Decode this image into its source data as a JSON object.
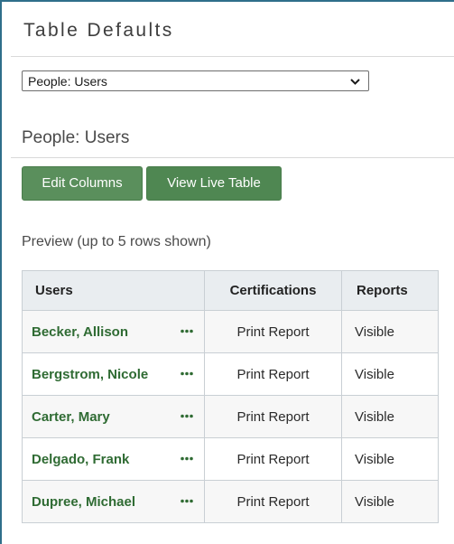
{
  "panel": {
    "title": "Table Defaults"
  },
  "table_select": {
    "value": "People: Users",
    "icon": "chevron-down-icon"
  },
  "section": {
    "title": "People: Users"
  },
  "buttons": {
    "edit_columns": "Edit Columns",
    "view_live_table": "View Live Table"
  },
  "preview": {
    "label": "Preview (up to 5 rows shown)"
  },
  "table": {
    "headers": [
      "Users",
      "Certifications",
      "Reports"
    ],
    "row_action_icon": "more-horizontal-icon",
    "rows": [
      {
        "user": "Becker, Allison",
        "certifications": "Print Report",
        "reports": "Visible"
      },
      {
        "user": "Bergstrom, Nicole",
        "certifications": "Print Report",
        "reports": "Visible"
      },
      {
        "user": "Carter, Mary",
        "certifications": "Print Report",
        "reports": "Visible"
      },
      {
        "user": "Delgado, Frank",
        "certifications": "Print Report",
        "reports": "Visible"
      },
      {
        "user": "Dupree, Michael",
        "certifications": "Print Report",
        "reports": "Visible"
      }
    ]
  },
  "colors": {
    "accent_green": "#5a8f5c",
    "link_green": "#2f6b33",
    "frame_blue": "#2f6f8a"
  }
}
